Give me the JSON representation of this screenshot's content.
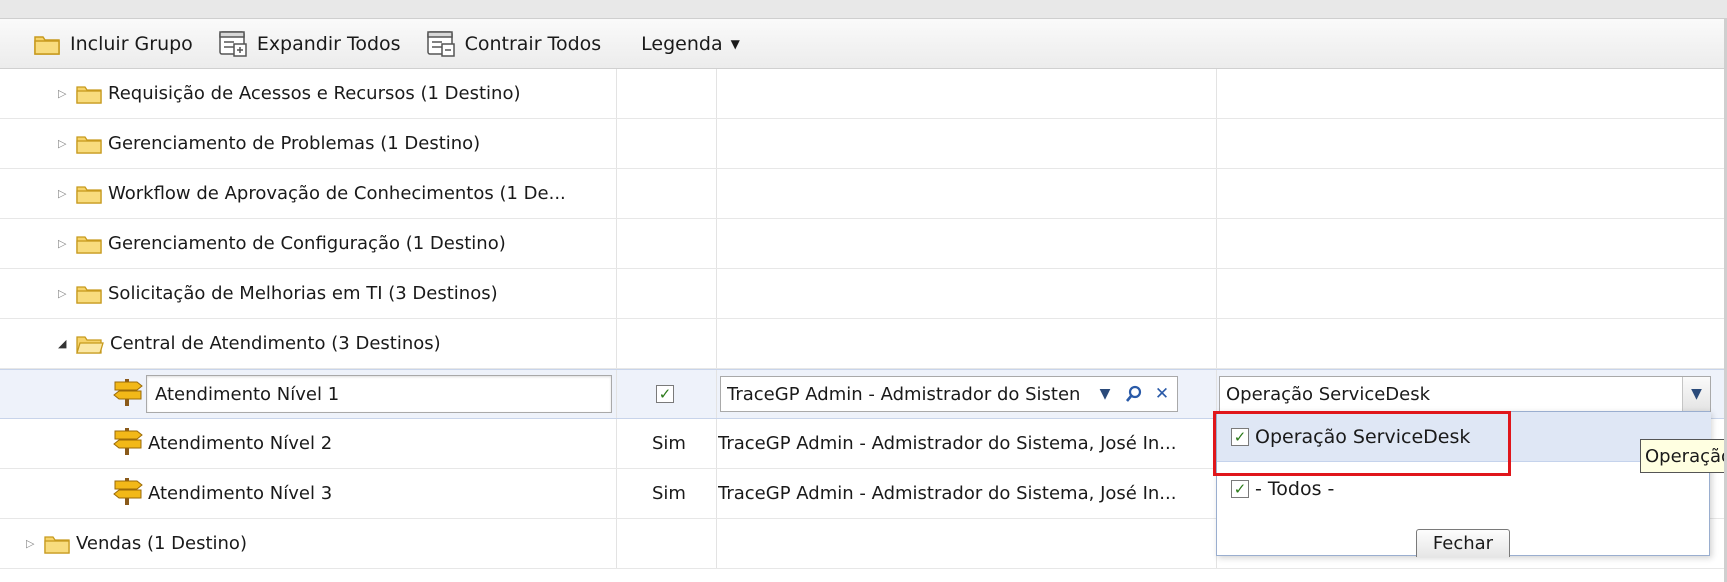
{
  "toolbar": {
    "include_group": "Incluir Grupo",
    "expand_all": "Expandir Todos",
    "collapse_all": "Contrair Todos",
    "legend": "Legenda"
  },
  "groups": [
    {
      "label": "Requisição de Acessos e Recursos (1 Destino)",
      "expanded": false
    },
    {
      "label": "Gerenciamento de Problemas (1 Destino)",
      "expanded": false
    },
    {
      "label": "Workflow de Aprovação de Conhecimentos (1 De...",
      "expanded": false
    },
    {
      "label": "Gerenciamento de Configuração (1 Destino)",
      "expanded": false
    },
    {
      "label": "Solicitação de Melhorias em TI (3 Destinos)",
      "expanded": false
    },
    {
      "label": "Central de Atendimento (3 Destinos)",
      "expanded": true
    }
  ],
  "destinations": [
    {
      "name": "Atendimento Nível 1",
      "flag_checked": true,
      "responsible": "TraceGP Admin - Admistrador do Sisten",
      "team": "Operação ServiceDesk",
      "editing": true
    },
    {
      "name": "Atendimento Nível 2",
      "flag": "Sim",
      "responsible": "TraceGP Admin - Admistrador do Sistema, José In..."
    },
    {
      "name": "Atendimento Nível 3",
      "flag": "Sim",
      "responsible": "TraceGP Admin - Admistrador do Sistema, José In..."
    }
  ],
  "last_group": {
    "label": "Vendas (1 Destino)",
    "expanded": false
  },
  "dropdown": {
    "options": [
      {
        "label": "Operação ServiceDesk",
        "checked": true,
        "highlighted": true
      },
      {
        "label": "- Todos -",
        "checked": true
      }
    ],
    "close_label": "Fechar"
  },
  "tooltip": "Operação ServiceDesk",
  "colors": {
    "highlight_border": "#e0161b",
    "folder": "#f3c94a",
    "selected_row": "#eef2fa"
  }
}
